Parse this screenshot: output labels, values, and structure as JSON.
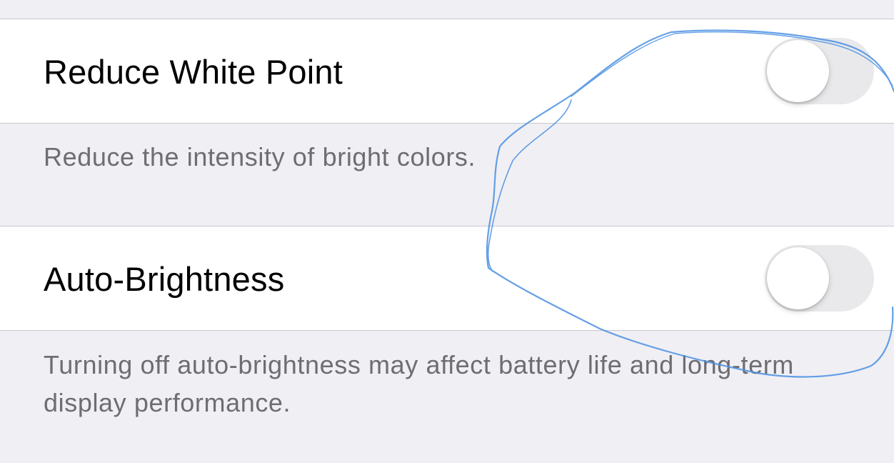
{
  "settings": [
    {
      "label": "Reduce White Point",
      "toggle_on": false,
      "footer": "Reduce the intensity of bright colors."
    },
    {
      "label": "Auto-Brightness",
      "toggle_on": false,
      "footer": "Turning off auto-brightness may affect battery life and long-term display performance."
    }
  ],
  "colors": {
    "background": "#f0eff4",
    "cell": "#ffffff",
    "separator": "#c8c7cc",
    "footer_text": "#6d6d72",
    "toggle_off_track": "#e9e9eb",
    "scribble": "#4a90e2"
  }
}
